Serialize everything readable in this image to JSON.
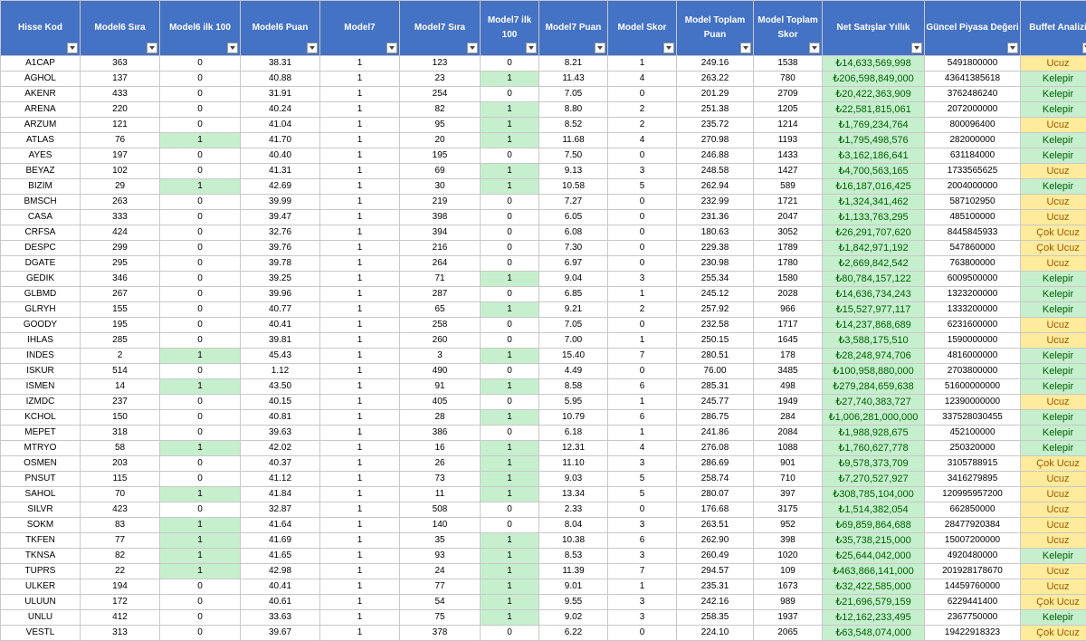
{
  "columns": [
    {
      "label": "Hisse Kod"
    },
    {
      "label": "Model6 Sıra"
    },
    {
      "label": "Model6 ilk 100"
    },
    {
      "label": "Model6 Puan"
    },
    {
      "label": "Model7"
    },
    {
      "label": "Model7 Sıra"
    },
    {
      "label": "Model7 ilk 100"
    },
    {
      "label": "Model7 Puan"
    },
    {
      "label": "Model Skor"
    },
    {
      "label": "Model Toplam Puan"
    },
    {
      "label": "Model Toplam Skor"
    },
    {
      "label": "Net Satışlar Yıllık"
    },
    {
      "label": "Güncel Piyasa Değeri"
    },
    {
      "label": "Buffet Analizi"
    }
  ],
  "colors": {
    "header_bg": "#4472c4",
    "green_fill": "#c6efce",
    "green_text": "#006100",
    "yellow_fill": "#ffeb9c",
    "yellow_text": "#9c5700"
  },
  "rows": [
    [
      "A1CAP",
      "363",
      "0",
      "38.31",
      "1",
      "123",
      "0",
      "8.21",
      "1",
      "249.16",
      "1538",
      "₺14,633,569,998",
      "5491800000",
      "Ucuz"
    ],
    [
      "AGHOL",
      "137",
      "0",
      "40.88",
      "1",
      "23",
      "1",
      "11.43",
      "4",
      "263.22",
      "780",
      "₺206,598,849,000",
      "43641385618",
      "Kelepir"
    ],
    [
      "AKENR",
      "433",
      "0",
      "31.91",
      "1",
      "254",
      "0",
      "7.05",
      "0",
      "201.29",
      "2709",
      "₺20,422,363,909",
      "3762486240",
      "Kelepir"
    ],
    [
      "ARENA",
      "220",
      "0",
      "40.24",
      "1",
      "82",
      "1",
      "8.80",
      "2",
      "251.38",
      "1205",
      "₺22,581,815,061",
      "2072000000",
      "Kelepir"
    ],
    [
      "ARZUM",
      "121",
      "0",
      "41.04",
      "1",
      "95",
      "1",
      "8.52",
      "2",
      "235.72",
      "1214",
      "₺1,769,234,764",
      "800096400",
      "Ucuz"
    ],
    [
      "ATLAS",
      "76",
      "1",
      "41.70",
      "1",
      "20",
      "1",
      "11.68",
      "4",
      "270.98",
      "1193",
      "₺1,795,498,576",
      "282000000",
      "Kelepir"
    ],
    [
      "AYES",
      "197",
      "0",
      "40.40",
      "1",
      "195",
      "0",
      "7.50",
      "0",
      "246.88",
      "1433",
      "₺3,162,186,641",
      "631184000",
      "Kelepir"
    ],
    [
      "BEYAZ",
      "102",
      "0",
      "41.31",
      "1",
      "69",
      "1",
      "9.13",
      "3",
      "248.58",
      "1427",
      "₺4,700,563,165",
      "1733565625",
      "Ucuz"
    ],
    [
      "BIZIM",
      "29",
      "1",
      "42.69",
      "1",
      "30",
      "1",
      "10.58",
      "5",
      "262.94",
      "589",
      "₺16,187,016,425",
      "2004000000",
      "Kelepir"
    ],
    [
      "BMSCH",
      "263",
      "0",
      "39.99",
      "1",
      "219",
      "0",
      "7.27",
      "0",
      "232.99",
      "1721",
      "₺1,324,341,462",
      "587102950",
      "Ucuz"
    ],
    [
      "CASA",
      "333",
      "0",
      "39.47",
      "1",
      "398",
      "0",
      "6.05",
      "0",
      "231.36",
      "2047",
      "₺1,133,763,295",
      "485100000",
      "Ucuz"
    ],
    [
      "CRFSA",
      "424",
      "0",
      "32.76",
      "1",
      "394",
      "0",
      "6.08",
      "0",
      "180.63",
      "3052",
      "₺26,291,707,620",
      "8445845933",
      "Çok Ucuz"
    ],
    [
      "DESPC",
      "299",
      "0",
      "39.76",
      "1",
      "216",
      "0",
      "7.30",
      "0",
      "229.38",
      "1789",
      "₺1,842,971,192",
      "547860000",
      "Çok Ucuz"
    ],
    [
      "DGATE",
      "295",
      "0",
      "39.78",
      "1",
      "264",
      "0",
      "6.97",
      "0",
      "230.98",
      "1780",
      "₺2,669,842,542",
      "763800000",
      "Ucuz"
    ],
    [
      "GEDIK",
      "346",
      "0",
      "39.25",
      "1",
      "71",
      "1",
      "9.04",
      "3",
      "255.34",
      "1580",
      "₺80,784,157,122",
      "6009500000",
      "Kelepir"
    ],
    [
      "GLBMD",
      "267",
      "0",
      "39.96",
      "1",
      "287",
      "0",
      "6.85",
      "1",
      "245.12",
      "2028",
      "₺14,636,734,243",
      "1323200000",
      "Kelepir"
    ],
    [
      "GLRYH",
      "155",
      "0",
      "40.77",
      "1",
      "65",
      "1",
      "9.21",
      "2",
      "257.92",
      "966",
      "₺15,527,977,117",
      "1333200000",
      "Kelepir"
    ],
    [
      "GOODY",
      "195",
      "0",
      "40.41",
      "1",
      "258",
      "0",
      "7.05",
      "0",
      "232.58",
      "1717",
      "₺14,237,868,689",
      "6231600000",
      "Ucuz"
    ],
    [
      "IHLAS",
      "285",
      "0",
      "39.81",
      "1",
      "260",
      "0",
      "7.00",
      "1",
      "250.15",
      "1645",
      "₺3,588,175,510",
      "1590000000",
      "Ucuz"
    ],
    [
      "INDES",
      "2",
      "1",
      "45.43",
      "1",
      "3",
      "1",
      "15.40",
      "7",
      "280.51",
      "178",
      "₺28,248,974,706",
      "4816000000",
      "Kelepir"
    ],
    [
      "ISKUR",
      "514",
      "0",
      "1.12",
      "1",
      "490",
      "0",
      "4.49",
      "0",
      "76.00",
      "3485",
      "₺100,958,880,000",
      "2703800000",
      "Kelepir"
    ],
    [
      "ISMEN",
      "14",
      "1",
      "43.50",
      "1",
      "91",
      "1",
      "8.58",
      "6",
      "285.31",
      "498",
      "₺279,284,659,638",
      "51600000000",
      "Kelepir"
    ],
    [
      "IZMDC",
      "237",
      "0",
      "40.15",
      "1",
      "405",
      "0",
      "5.95",
      "1",
      "245.77",
      "1949",
      "₺27,740,383,727",
      "12390000000",
      "Ucuz"
    ],
    [
      "KCHOL",
      "150",
      "0",
      "40.81",
      "1",
      "28",
      "1",
      "10.79",
      "6",
      "286.75",
      "284",
      "₺1,006,281,000,000",
      "337528030455",
      "Kelepir"
    ],
    [
      "MEPET",
      "318",
      "0",
      "39.63",
      "1",
      "386",
      "0",
      "6.18",
      "1",
      "241.86",
      "2084",
      "₺1,988,928,675",
      "452100000",
      "Kelepir"
    ],
    [
      "MTRYO",
      "58",
      "1",
      "42.02",
      "1",
      "16",
      "1",
      "12.31",
      "4",
      "276.08",
      "1088",
      "₺1,760,627,778",
      "250320000",
      "Kelepir"
    ],
    [
      "OSMEN",
      "203",
      "0",
      "40.37",
      "1",
      "26",
      "1",
      "11.10",
      "3",
      "286.69",
      "901",
      "₺9,578,373,709",
      "3105788915",
      "Çok Ucuz"
    ],
    [
      "PNSUT",
      "115",
      "0",
      "41.12",
      "1",
      "73",
      "1",
      "9.03",
      "5",
      "258.74",
      "710",
      "₺7,270,527,927",
      "3416279895",
      "Ucuz"
    ],
    [
      "SAHOL",
      "70",
      "1",
      "41.84",
      "1",
      "11",
      "1",
      "13.34",
      "5",
      "280.07",
      "397",
      "₺308,785,104,000",
      "120995957200",
      "Ucuz"
    ],
    [
      "SILVR",
      "423",
      "0",
      "32.87",
      "1",
      "508",
      "0",
      "2.33",
      "0",
      "176.68",
      "3175",
      "₺1,514,382,054",
      "662850000",
      "Ucuz"
    ],
    [
      "SOKM",
      "83",
      "1",
      "41.64",
      "1",
      "140",
      "0",
      "8.04",
      "3",
      "263.51",
      "952",
      "₺69,859,864,688",
      "28477920384",
      "Ucuz"
    ],
    [
      "TKFEN",
      "77",
      "1",
      "41.69",
      "1",
      "35",
      "1",
      "10.38",
      "6",
      "262.90",
      "398",
      "₺35,738,215,000",
      "15007200000",
      "Ucuz"
    ],
    [
      "TKNSA",
      "82",
      "1",
      "41.65",
      "1",
      "93",
      "1",
      "8.53",
      "3",
      "260.49",
      "1020",
      "₺25,644,042,000",
      "4920480000",
      "Kelepir"
    ],
    [
      "TUPRS",
      "22",
      "1",
      "42.98",
      "1",
      "24",
      "1",
      "11.39",
      "7",
      "294.57",
      "109",
      "₺463,866,141,000",
      "201928178670",
      "Ucuz"
    ],
    [
      "ULKER",
      "194",
      "0",
      "40.41",
      "1",
      "77",
      "1",
      "9.01",
      "1",
      "235.31",
      "1673",
      "₺32,422,585,000",
      "14459760000",
      "Ucuz"
    ],
    [
      "ULUUN",
      "172",
      "0",
      "40.61",
      "1",
      "54",
      "1",
      "9.55",
      "3",
      "242.16",
      "989",
      "₺21,696,579,159",
      "6229441400",
      "Çok Ucuz"
    ],
    [
      "UNLU",
      "412",
      "0",
      "33.63",
      "1",
      "75",
      "1",
      "9.02",
      "3",
      "258.35",
      "1937",
      "₺12,162,233,495",
      "2367750000",
      "Kelepir"
    ],
    [
      "VESTL",
      "313",
      "0",
      "39.67",
      "1",
      "378",
      "0",
      "6.22",
      "0",
      "224.10",
      "2065",
      "₺63,548,074,000",
      "19422918323",
      "Çok Ucuz"
    ]
  ]
}
